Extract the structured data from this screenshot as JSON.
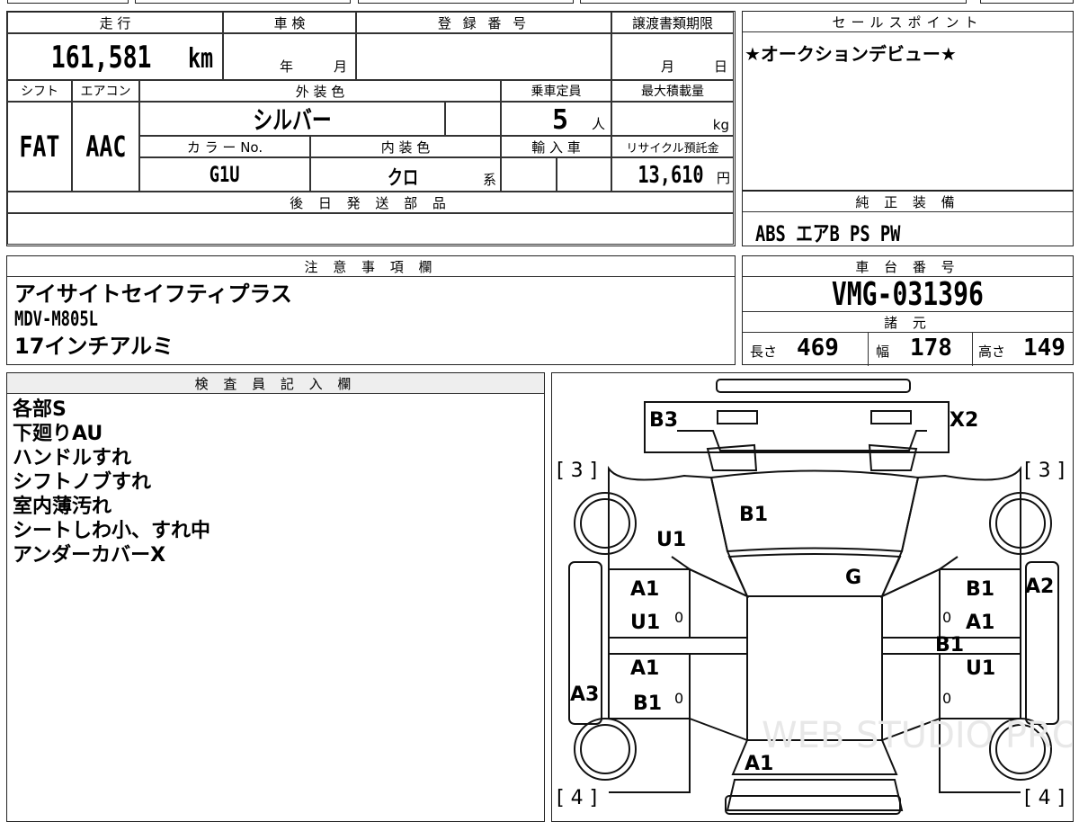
{
  "row1": {
    "mileage_label": "走 行",
    "mileage_value": "161,581",
    "mileage_unit": "km",
    "inspection_label": "車 検",
    "inspection_year": "年",
    "inspection_month": "月",
    "registration_label": "登 録 番 号",
    "transfer_label": "譲渡書類期限",
    "transfer_month": "月",
    "transfer_day": "日"
  },
  "row2": {
    "shift_label": "シフト",
    "ac_label": "エアコン",
    "exterior_label": "外 装 色",
    "capacity_label": "乗車定員",
    "maxload_label": "最大積載量",
    "shift_value": "FAT",
    "ac_value": "AAC",
    "exterior_value": "シルバー",
    "capacity_value": "5",
    "capacity_unit": "人",
    "maxload_unit": "kg",
    "color_no_label": "カ ラ ー No.",
    "interior_label": "内 装 色",
    "import_label": "輸 入 車",
    "recycle_label": "リサイクル預託金",
    "color_no_value": "G1U",
    "interior_value": "クロ",
    "interior_suffix": "系",
    "recycle_value": "13,610",
    "recycle_unit": "円"
  },
  "later_parts_label": "後 日 発 送 部 品",
  "sales_point": {
    "label": "セールスポイント",
    "text": "★オークションデビュー★"
  },
  "equipment": {
    "label": "純 正 装 備",
    "text": "ABS エアB PS PW"
  },
  "notes": {
    "label": "注 意 事 項 欄",
    "lines": [
      "アイサイトセイフティプラス",
      "MDV-M805L",
      "17インチアルミ"
    ]
  },
  "chassis": {
    "label": "車 台 番 号",
    "value": "VMG-031396"
  },
  "specs": {
    "label": "諸 元",
    "length_label": "長さ",
    "length_value": "469",
    "width_label": "幅",
    "width_value": "178",
    "height_label": "高さ",
    "height_value": "149"
  },
  "inspector": {
    "label": "検 査 員 記 入 欄",
    "lines": [
      "各部S",
      "下廻りAU",
      "ハンドルすれ",
      "シフトノブすれ",
      "室内薄汚れ",
      "シートしわ小、すれ中",
      "アンダーカバーX"
    ]
  },
  "diagram": {
    "tire_front_left": "[ 3 ]",
    "tire_front_right": "[ 3 ]",
    "tire_rear_left": "[ 4 ]",
    "tire_rear_right": "[ 4 ]",
    "marks": {
      "front_left_bumper": "B3",
      "front_right_bumper": "X2",
      "hood": "B1",
      "left_fender": "U1",
      "windshield": "G",
      "left_front_door_1": "A1",
      "left_front_door_2": "U1",
      "left_rear_door_1": "A1",
      "left_rear_door_2": "B1",
      "left_rocker": "A3",
      "right_front_door": "B1",
      "right_pillar": "A2",
      "right_front_door_2": "A1",
      "right_center": "B1",
      "right_rear_door": "U1",
      "trunk": "A1",
      "zero_1": "0",
      "zero_2": "0",
      "zero_3": "0",
      "zero_4": "0"
    },
    "watermark": "WEB STUDIO PRO"
  }
}
